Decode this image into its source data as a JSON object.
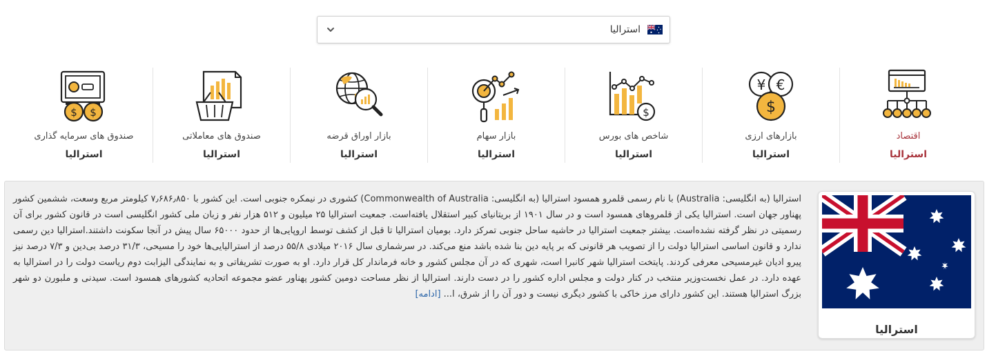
{
  "selector": {
    "value": "استرالیا",
    "flag_icon": "australia-flag-icon",
    "chevron_icon": "chevron-down-icon"
  },
  "categories": [
    {
      "title": "اقتصاد",
      "country": "استرالیا",
      "icon": "economy-network-icon",
      "active": true
    },
    {
      "title": "بازارهای ارزی",
      "country": "استرالیا",
      "icon": "currency-coins-icon"
    },
    {
      "title": "شاخص های بورس",
      "country": "استرالیا",
      "icon": "stock-index-chart-icon"
    },
    {
      "title": "بازار سهام",
      "country": "استرالیا",
      "icon": "stock-market-icon"
    },
    {
      "title": "بازار اوراق قرضه",
      "country": "استرالیا",
      "icon": "bond-market-globe-icon"
    },
    {
      "title": "صندوق های معاملاتی",
      "country": "استرالیا",
      "icon": "trading-fund-basket-icon"
    },
    {
      "title": "صندوق های سرمایه گذاری",
      "country": "استرالیا",
      "icon": "investment-fund-safe-icon"
    }
  ],
  "country_card": {
    "name": "استرالیا",
    "flag_icon": "australia-flag-icon"
  },
  "description": {
    "text": "استرالیا (به انگلیسی: Australia) با نام رسمی قلمرو همسود استرالیا (به انگلیسی: Commonwealth of Australia) کشوری در نیمکره جنوبی است. این کشور با ۷٫۶۸۶٫۸۵۰ کیلومتر مربع وسعت، ششمین کشور پهناور جهان است. استرالیا یکی از قلمروهای همسود است و در سال ۱۹۰۱ از بریتانیای کبیر استقلال یافته‌است. جمعیت استرالیا ۲۵ میلیون و ۵۱۲ هزار نفر و زبان ملی کشور انگلیسی است در قانون کشور برای آن رسمیتی در نظر گرفته نشده‌است. بیشتر جمعیت استرالیا در حاشیه ساحل جنوبی تمرکز دارد. بومیان استرالیا تا قبل از کشف توسط اروپایی‌ها از حدود ۶۵۰۰۰ سال پیش در آنجا سکونت داشتند.استرالیا دین رسمی ندارد و قانون اساسی استرالیا دولت را از تصویب هر قانونی که بر پایه دین بنا شده باشد منع می‌کند. در سرشماری سال ۲۰۱۶ میلادی ۵۵/۸ درصد از استرالیایی‌ها خود را مسیحی، ۳۱/۳ درصد بی‌دین و ۷/۳ درصد نیز پیرو ادیان غیرمسیحی معرفی کردند. پایتخت استرالیا شهر کانبرا است، شهری که در آن مجلس کشور و خانه فرماندار کل قرار دارد. او به صورت تشریفاتی و به نمایندگی الیزابت دوم ریاست دولت را در استرالیا به عهده دارد. در عمل نخست‌وزیر منتخب در کنار دولت و مجلس اداره کشور را در دست دارند. استرالیا از نظر مساحت دومین کشور پهناور عضو مجموعه اتحادیه کشورهای همسود است. سیدنی و ملبورن دو شهر بزرگ استرالیا هستند. این کشور دارای مرز خاکی با کشور دیگری نیست و دور آن را از شرق، ا...",
    "more_link": "[ادامه]"
  },
  "colors": {
    "accent": "#a8323a",
    "icon_gold": "#f3b63f",
    "link": "#2a64a8",
    "flag_blue": "#012169",
    "flag_red": "#c8102e"
  }
}
